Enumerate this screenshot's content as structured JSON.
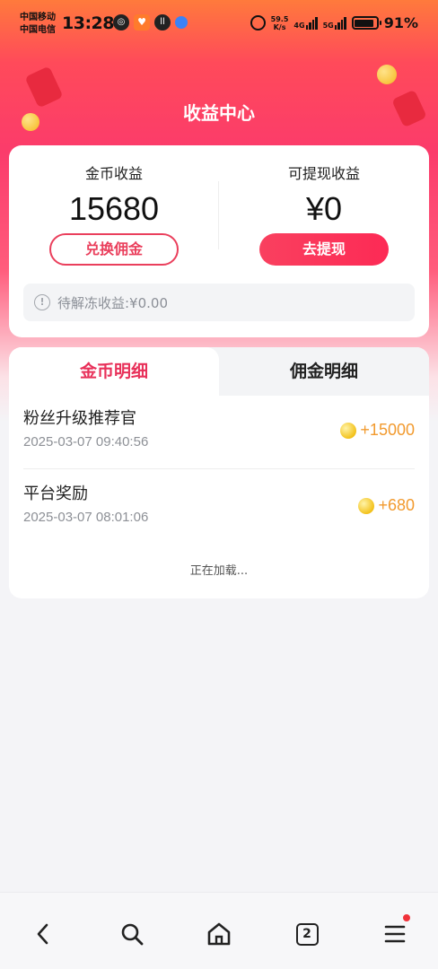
{
  "status_bar": {
    "carrier1": "中国移动",
    "carrier2": "中国电信",
    "time": "13:28",
    "net_speed_value": "59.5",
    "net_speed_unit": "K/s",
    "sim1_type": "4G",
    "sim2_type": "5G",
    "battery": "91%"
  },
  "header": {
    "title": "收益中心"
  },
  "earnings": {
    "coin_label": "金币收益",
    "coin_value": "15680",
    "exchange_button": "兑换佣金",
    "withdrawable_label": "可提现收益",
    "withdrawable_value": "¥0",
    "withdraw_button": "去提现",
    "frozen_text": "待解冻收益:¥0.00"
  },
  "details": {
    "tabs": [
      {
        "label": "金币明细",
        "active": true
      },
      {
        "label": "佣金明细",
        "active": false
      }
    ],
    "transactions": [
      {
        "title": "粉丝升级推荐官",
        "date": "2025-03-07 09:40:56",
        "amount": "+15000"
      },
      {
        "title": "平台奖励",
        "date": "2025-03-07 08:01:06",
        "amount": "+680"
      }
    ],
    "loading_text": "正在加载..."
  },
  "bottom_nav": {
    "items": [
      "back-icon",
      "search-icon",
      "home-icon",
      "tabs-icon",
      "menu-icon"
    ],
    "tab_count": "2"
  },
  "colors": {
    "accent": "#e8315a",
    "coin_amount": "#f29a2e",
    "header_gradient_top": "#ff7a3c",
    "header_gradient_mid": "#fb3b6b"
  }
}
